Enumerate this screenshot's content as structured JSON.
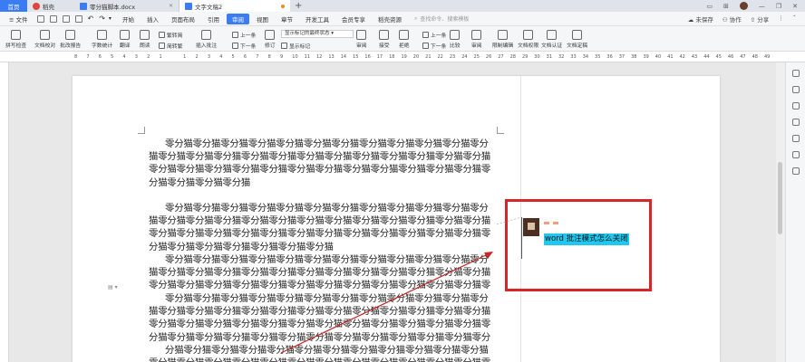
{
  "tabs": {
    "home": "首页",
    "docs": "稻壳",
    "file1": "零分猫脚本.docx",
    "file2": "文字文稿2",
    "new_tab": "+"
  },
  "menu": {
    "file": "≡ 文件",
    "items": [
      "开始",
      "插入",
      "页面布局",
      "引用",
      "审阅",
      "视图",
      "章节",
      "开发工具",
      "会员专享",
      "稻壳资源"
    ],
    "search_placeholder": "查找命令、搜索模板",
    "unsaved": "未保存",
    "collab": "协作",
    "share": "分享"
  },
  "ribbon": {
    "spell_check": "拼写检查",
    "doc_proof": "文档校对",
    "paper_check": "批改报告",
    "word_count": "字数统计",
    "translate": "翻译",
    "read_aloud": "朗读",
    "trad": "繁转简",
    "simp": "简转繁",
    "insert_comment": "插入批注",
    "prev": "上一条",
    "next": "下一条",
    "delete": "删除",
    "track": "修订",
    "display_markup": "显示标记的最终状态",
    "show_markup": "显示标记",
    "review": "审阅",
    "accept": "接受",
    "reject": "拒绝",
    "prev2": "上一条",
    "next2": "下一条",
    "compare": "比较",
    "limit_edit": "限制编辑",
    "protect": "文档权限",
    "certify": "文档认证",
    "finalize": "文档定稿"
  },
  "ruler_numbers": [
    "8",
    "7",
    "6",
    "5",
    "4",
    "3",
    "2",
    "1",
    "",
    "1",
    "2",
    "3",
    "4",
    "5",
    "6",
    "7",
    "8",
    "9",
    "10",
    "11",
    "12",
    "13",
    "14",
    "15",
    "16",
    "17",
    "18",
    "19",
    "20",
    "21",
    "22",
    "23",
    "24",
    "25",
    "26",
    "27",
    "28",
    "29",
    "30",
    "31",
    "32",
    "33",
    "34",
    "35",
    "36",
    "37",
    "38",
    "39",
    "40",
    "41",
    "42",
    "43",
    "44",
    "45",
    "46",
    "47",
    "48",
    "49"
  ],
  "document": {
    "paragraphs": [
      "零分猫零分猫零分猫零分猫零分猫零分猫零分猫零分猫零分猫零分猫零分猫零分猫零分猫零分猫零分猫零分猫零分猫零分猫零分猫零分猫零分猫零分猫零分猫零分猫零分猫零分猫零分猫零分猫零分猫零分猫零分猫零分猫零分猫零分猫零分猫零分猫零分猫零分猫零分猫零分猫",
      "零分猫零分猫零分猫零分猫零分猫零分猫零分猫零分猫零分猫零分猫零分猫零分猫零分猫零分猫零分猫零分猫零分猫零分猫零分猫零分猫零分猫零分猫零分猫零分猫零分猫零分猫零分猫零分猫零分猫零分猫零分猫零分猫零分猫零分猫零分猫零分猫零分猫零分猫零分猫零分猫零分猫零分猫零分猫",
      "零分猫零分猫零分猫零分猫零分猫零分猫零分猫零分猫零分猫零分猫零分猫零分猫零分猫零分猫零分猫零分猫零分猫零分猫零分猫零分猫零分猫零分猫零分猫零分猫零分猫零分猫零分猫零分猫零分猫零分猫零分猫零分猫零分猫零分猫零分猫零分猫零分猫零分猫零分猫零分猫零分猫零分猫零分猫零分猫零分猫零分猫零分猫零分猫零分猫零分猫零分猫零分",
      "零分猫零分猫零分猫零分猫零分猫零分猫零分猫零分猫零分猫零分猫零分猫零分猫零分猫零分猫零分猫零分猫零分猫零分猫零分猫零分猫零分猫零分猫零分猫零分猫零分猫零分猫零分猫零分猫零分猫零分猫零分猫零分猫零分猫零分猫零分猫零分猫零分猫零分猫零分猫零分猫零分猫零分猫零分猫零分猫零分猫零分猫零分猫零分猫零分猫",
      "分猫零分猫零分猫零分猫零分猫零分猫零分猫零分猫零分猫零分猫零分猫零分猫零分猫零分猫零分猫零分猫零分猫零分猫零分猫零分猫零分猫零分猫零分猫零分猫零分猫零分猫"
    ]
  },
  "comment": {
    "text": "word 批注模式怎么关闭"
  },
  "colors": {
    "accent": "#3b7cf5",
    "highlight_box": "#d9252a",
    "comment_highlight": "#1ec8f0",
    "arrow": "#c62828"
  }
}
